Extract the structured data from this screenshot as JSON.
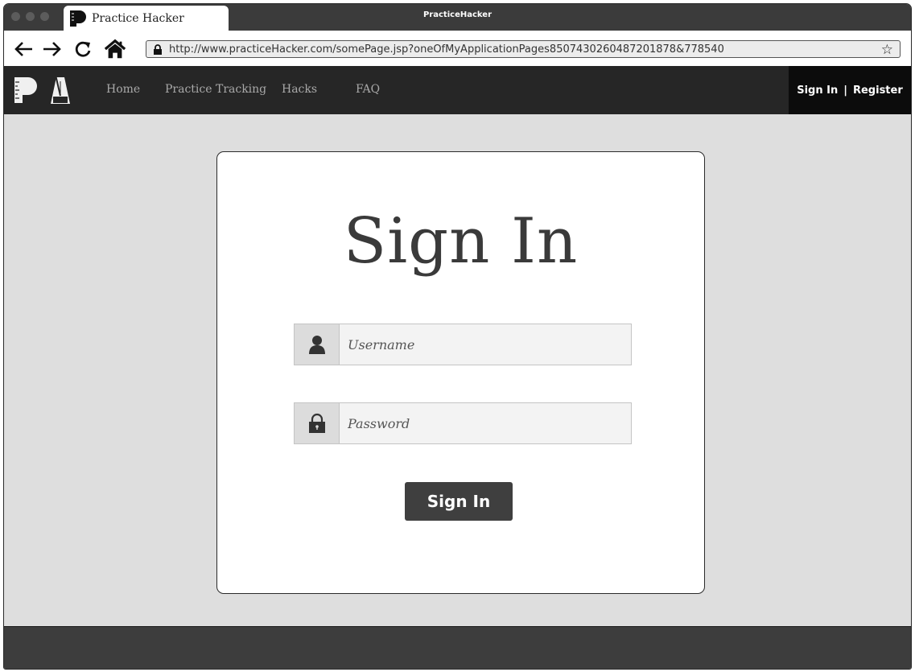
{
  "browser": {
    "tab_title": "Practice Hacker",
    "window_title": "PracticeHacker",
    "url": "http://www.practiceHacker.com/somePage.jsp?oneOfMyApplicationPages8507430260487201878&778540"
  },
  "nav": {
    "links": [
      "Home",
      "Practice Tracking",
      "Hacks",
      "FAQ"
    ],
    "sign_in": "Sign In",
    "separator": "|",
    "register": "Register"
  },
  "login": {
    "title": "Sign In",
    "username_placeholder": "Username",
    "password_placeholder": "Password",
    "submit_label": "Sign In"
  },
  "icons": {
    "back": "arrow-left-icon",
    "forward": "arrow-right-icon",
    "reload": "reload-icon",
    "home": "home-icon",
    "secure": "lock-icon",
    "bookmark": "star-icon",
    "user": "user-icon",
    "password": "padlock-icon"
  },
  "colors": {
    "nav_bg": "#262626",
    "auth_bg": "#0c0c0c",
    "page_bg": "#dedede",
    "button_bg": "#3f3f3f",
    "footer_bg": "#3d3d3d"
  }
}
